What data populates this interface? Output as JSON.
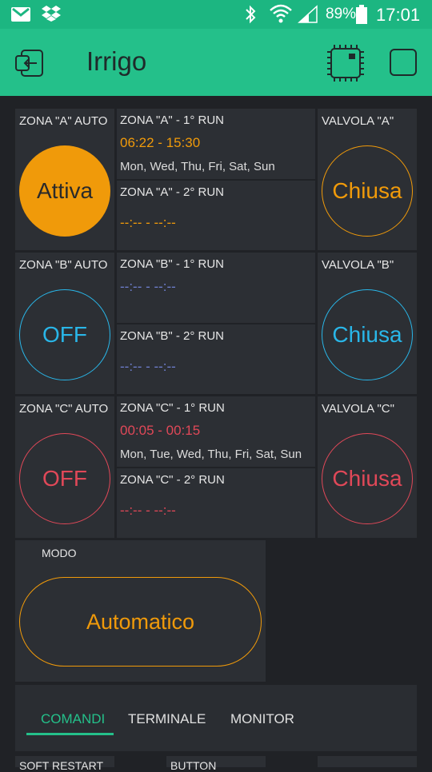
{
  "status_bar": {
    "battery": "89%",
    "time": "17:01"
  },
  "app": {
    "title": "Irrigo"
  },
  "zones": [
    {
      "auto_label": "ZONA  \"A\" AUTO",
      "auto_state": "Attiva",
      "run1_label": "ZONA \"A\" - 1° RUN",
      "run1_time": "06:22 - 15:30",
      "run1_days": "Mon, Wed, Thu, Fri, Sat, Sun",
      "run2_label": "ZONA \"A\" - 2°  RUN",
      "run2_time": "--:-- - --:--",
      "valve_label": "VALVOLA \"A\"",
      "valve_state": "Chiusa",
      "color": "#f09a0a"
    },
    {
      "auto_label": "ZONA \"B\" AUTO",
      "auto_state": "OFF",
      "run1_label": "ZONA \"B\" - 1° RUN",
      "run1_time": "--:-- - --:--",
      "run1_days": "",
      "run2_label": "ZONA \"B\" - 2° RUN",
      "run2_time": "--:-- - --:--",
      "valve_label": "VALVOLA \"B\"",
      "valve_state": "Chiusa",
      "color": "#29b6e8",
      "time_color": "#6f7fd0"
    },
    {
      "auto_label": "ZONA \"C\" AUTO",
      "auto_state": "OFF",
      "run1_label": "ZONA \"C\" - 1° RUN",
      "run1_time": "00:05 - 00:15",
      "run1_days": "Mon, Tue, Wed, Thu, Fri, Sat, Sun",
      "run2_label": "ZONA \"C\" - 2° RUN",
      "run2_time": "--:-- - --:--",
      "valve_label": "VALVOLA \"C\"",
      "valve_state": "Chiusa",
      "color": "#e04858"
    }
  ],
  "mode": {
    "label": "MODO",
    "value": "Automatico",
    "color": "#f09a0a"
  },
  "tabs": [
    {
      "label": "COMANDI",
      "active": true
    },
    {
      "label": "TERMINALE",
      "active": false
    },
    {
      "label": "MONITOR",
      "active": false
    }
  ],
  "bottom_tiles": {
    "soft_restart": "SOFT RESTART",
    "button": "BUTTON"
  },
  "colors": {
    "accent": "#24c08a",
    "background": "#202226",
    "tile": "#2c2f34"
  }
}
